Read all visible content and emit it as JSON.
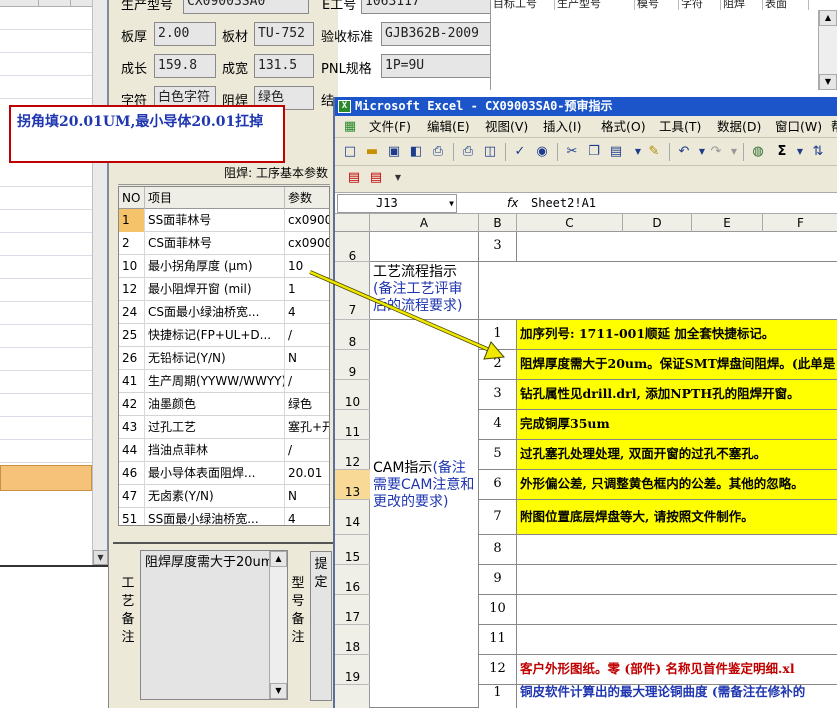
{
  "form": {
    "row0": {
      "lbl1": "生产型号",
      "val1": "CX09003SA0",
      "lbl2": "E工号",
      "val2": "1063117"
    },
    "row1": {
      "lbl1": "板厚",
      "val1": "2.00",
      "lbl2": "板材",
      "val2": "TU-752",
      "lbl3": "验收标准",
      "val3": "GJB362B-2009"
    },
    "row2": {
      "lbl1": "成长",
      "val1": "159.8",
      "lbl2": "成宽",
      "val2": "131.5",
      "lbl3": "PNL规格",
      "val3": "1P=9U"
    },
    "row3": {
      "lbl1": "字符",
      "val1": "白色字符",
      "lbl2": "阻焊",
      "val2": "绿色",
      "lbl3": "结"
    },
    "grid_title": "阻焊: 工序基本参数",
    "grid_headers": [
      "NO",
      "项目",
      "参数"
    ],
    "grid_rows": [
      {
        "no": "1",
        "item": "SS面菲林号",
        "param": "cx0900"
      },
      {
        "no": "2",
        "item": "CS面菲林号",
        "param": "cx0900"
      },
      {
        "no": "10",
        "item": "最小拐角厚度 (μm)",
        "param": "10"
      },
      {
        "no": "12",
        "item": "最小阻焊开窗 (mil)",
        "param": "1"
      },
      {
        "no": "24",
        "item": "CS面最小绿油桥宽...",
        "param": "4"
      },
      {
        "no": "25",
        "item": "快捷标记(FP+UL+D...",
        "param": "/"
      },
      {
        "no": "26",
        "item": "无铅标记(Y/N)",
        "param": "N"
      },
      {
        "no": "41",
        "item": "生产周期(YYWW/WWYY)",
        "param": "/"
      },
      {
        "no": "42",
        "item": "油墨颜色",
        "param": "绿色"
      },
      {
        "no": "43",
        "item": "过孔工艺",
        "param": "塞孔+开"
      },
      {
        "no": "44",
        "item": "挡油点菲林",
        "param": "/"
      },
      {
        "no": "46",
        "item": "最小导体表面阻焊...",
        "param": "20.01"
      },
      {
        "no": "47",
        "item": "无卤素(Y/N)",
        "param": "N"
      },
      {
        "no": "51",
        "item": "SS面最小绿油桥宽...",
        "param": "4"
      }
    ],
    "note_label": [
      "工",
      "艺",
      "备",
      "注"
    ],
    "note_text": "阻焊厚度需大于20um",
    "model_label": [
      "型",
      "号",
      "备",
      "注"
    ],
    "extra_label": [
      "提",
      "定"
    ]
  },
  "right_grid_headers": [
    "目标工号",
    "生产型号",
    "模号",
    "字符",
    "阻焊",
    "表面"
  ],
  "callout": {
    "text": "拐角填20.01UM,最小导体20.01扛掉",
    "border_color": "#c00000",
    "text_color": "#1f36b0"
  },
  "excel": {
    "title": "Microsoft Excel - CX09003SA0-预审指示",
    "menu": [
      "文件(F)",
      "编辑(E)",
      "视图(V)",
      "插入(I)",
      "格式(O)",
      "工具(T)",
      "数据(D)",
      "窗口(W)",
      "帮"
    ],
    "name_box": "J13",
    "formula": "Sheet2!A1",
    "columns": [
      "A",
      "B",
      "C",
      "D",
      "E",
      "F"
    ],
    "row_numbers": [
      "6",
      "7",
      "8",
      "9",
      "10",
      "11",
      "12",
      "13",
      "14",
      "15",
      "16",
      "17",
      "18",
      "19"
    ],
    "row6_b": "3",
    "section1": "工艺流程指示",
    "section1_note": "(备注工艺评审后的流程要求)",
    "section2": "CAM指示",
    "section2_note": "(备注需要CAM注意和更改的要求)",
    "items": [
      {
        "n": "1",
        "text": "加序列号: 1711-001顺延 加全套快捷标记。",
        "highlight": true
      },
      {
        "n": "2",
        "text": "阻焊厚度需大于20um。保证SMT焊盘间阻焊。(此单是",
        "highlight": true
      },
      {
        "n": "3",
        "text": "钻孔属性见drill.drl, 添加NPTH孔的阻焊开窗。",
        "highlight": true
      },
      {
        "n": "4",
        "text": "完成铜厚35um",
        "highlight": true
      },
      {
        "n": "5",
        "text": "过孔塞孔处理处理, 双面开窗的过孔不塞孔。",
        "highlight": true
      },
      {
        "n": "6",
        "text": "外形偏公差, 只调整黄色框内的公差。其他的忽略。",
        "highlight": true
      },
      {
        "n": "7",
        "text": "附图位置底层焊盘等大, 请按照文件制作。",
        "highlight": true
      },
      {
        "n": "8",
        "text": "",
        "highlight": false
      },
      {
        "n": "9",
        "text": "",
        "highlight": false
      },
      {
        "n": "10",
        "text": "",
        "highlight": false
      },
      {
        "n": "11",
        "text": "",
        "highlight": false
      },
      {
        "n": "12",
        "text": "客户外形图纸。零 (部件) 名称见首件鉴定明细.xl",
        "highlight": false,
        "red": true
      }
    ],
    "last_row_partial": "1",
    "last_row_text": "铜皮软件计算出的最大理论铜曲度 (需备注在修补的"
  },
  "colors": {
    "title_bar": "#1b55c9",
    "highlight": "#ffff00",
    "arrow": "#e8e000",
    "red_text": "#c00000"
  }
}
